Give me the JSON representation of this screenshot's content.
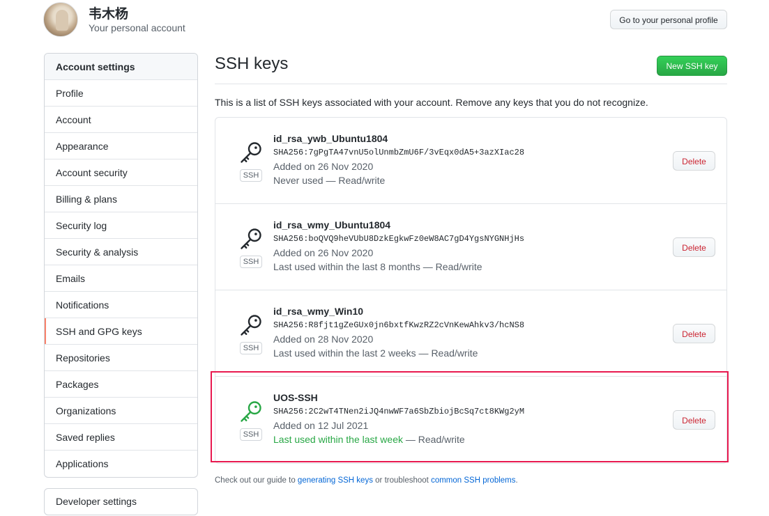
{
  "header": {
    "user_name": "韦木杨",
    "user_sub": "Your personal account",
    "profile_button": "Go to your personal profile"
  },
  "sidebar": {
    "heading": "Account settings",
    "items": [
      {
        "label": "Profile"
      },
      {
        "label": "Account"
      },
      {
        "label": "Appearance"
      },
      {
        "label": "Account security"
      },
      {
        "label": "Billing & plans"
      },
      {
        "label": "Security log"
      },
      {
        "label": "Security & analysis"
      },
      {
        "label": "Emails"
      },
      {
        "label": "Notifications"
      },
      {
        "label": "SSH and GPG keys"
      },
      {
        "label": "Repositories"
      },
      {
        "label": "Packages"
      },
      {
        "label": "Organizations"
      },
      {
        "label": "Saved replies"
      },
      {
        "label": "Applications"
      }
    ],
    "selected": "SSH and GPG keys",
    "developer_settings": "Developer settings"
  },
  "main": {
    "title": "SSH keys",
    "new_key_button": "New SSH key",
    "intro": "This is a list of SSH keys associated with your account. Remove any keys that you do not recognize.",
    "keys": [
      {
        "title": "id_rsa_ywb_Ubuntu1804",
        "fingerprint": "SHA256:7gPgTA47vnU5olUnmbZmU6F/3vEqx0dA5+3azXIac28",
        "added": "Added on 26 Nov 2020",
        "used_recent": "",
        "used": "Never used — Read/write",
        "badge": "SSH",
        "delete_label": "Delete",
        "icon_color": "#24292e"
      },
      {
        "title": "id_rsa_wmy_Ubuntu1804",
        "fingerprint": "SHA256:boQVQ9heVUbU8DzkEgkwFz0eW8AC7gD4YgsNYGNHjHs",
        "added": "Added on 26 Nov 2020",
        "used_recent": "",
        "used": "Last used within the last 8 months — Read/write",
        "badge": "SSH",
        "delete_label": "Delete",
        "icon_color": "#24292e"
      },
      {
        "title": "id_rsa_wmy_Win10",
        "fingerprint": "SHA256:R8fjt1gZeGUx0jn6bxtfKwzRZ2cVnKewAhkv3/hcNS8",
        "added": "Added on 28 Nov 2020",
        "used_recent": "",
        "used": "Last used within the last 2 weeks — Read/write",
        "badge": "SSH",
        "delete_label": "Delete",
        "icon_color": "#24292e"
      },
      {
        "title": "UOS-SSH",
        "fingerprint": "SHA256:2C2wT4TNen2iJQ4nwWF7a6SbZbiojBcSq7ct8KWg2yM",
        "added": "Added on 12 Jul 2021",
        "used_recent": "Last used within the last week",
        "used": " — Read/write",
        "badge": "SSH",
        "delete_label": "Delete",
        "icon_color": "#28a745"
      }
    ],
    "footer": {
      "prefix": "Check out our guide to ",
      "link1": "generating SSH keys",
      "middle": " or troubleshoot ",
      "link2": "common SSH problems",
      "suffix": "."
    }
  },
  "colors": {
    "accent_green": "#28a745",
    "danger_red": "#cb2431",
    "highlight": "#e8194f",
    "link_blue": "#0366d6",
    "selected_marker": "#f9826c"
  }
}
